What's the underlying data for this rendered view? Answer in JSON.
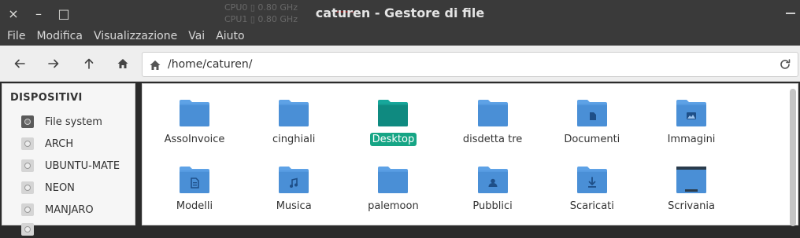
{
  "window": {
    "title": "caturen - Gestore di file",
    "controls": {
      "close": "×",
      "minimize": "–",
      "maximize": "□"
    },
    "overlay": {
      "rows": [
        "CPU0  ▯ 0.80 GHz",
        "CPU1  ▯ 0.80 GHz"
      ]
    }
  },
  "menubar": {
    "items": [
      "File",
      "Modifica",
      "Visualizzazione",
      "Vai",
      "Aiuto"
    ]
  },
  "toolbar": {
    "buttons": [
      "back-arrow-icon",
      "forward-arrow-icon",
      "up-arrow-icon",
      "home-icon"
    ],
    "location": "/home/caturen/"
  },
  "sidebar": {
    "header": "DISPOSITIVI",
    "devices": [
      "File system",
      "ARCH",
      "UBUNTU-MATE",
      "NEON",
      "MANJARO"
    ]
  },
  "files": [
    {
      "name": "AssoInvoice",
      "icon": "folder-icon"
    },
    {
      "name": "cinghiali",
      "icon": "folder-icon"
    },
    {
      "name": "Desktop",
      "icon": "folder-desktop-icon",
      "selected": true
    },
    {
      "name": "disdetta tre",
      "icon": "folder-icon"
    },
    {
      "name": "Documenti",
      "icon": "folder-documents-icon"
    },
    {
      "name": "Immagini",
      "icon": "folder-pictures-icon"
    },
    {
      "name": "Modelli",
      "icon": "folder-templates-icon"
    },
    {
      "name": "Musica",
      "icon": "folder-music-icon"
    },
    {
      "name": "palemoon",
      "icon": "folder-icon"
    },
    {
      "name": "Pubblici",
      "icon": "folder-public-icon"
    },
    {
      "name": "Scaricati",
      "icon": "folder-download-icon"
    },
    {
      "name": "Scrivania",
      "icon": "folder-desktop-dark-icon"
    }
  ],
  "colors": {
    "folder": "#4a8fd6",
    "folder_tab": "#5ea2e6",
    "desktop_folder": "#0f8a80",
    "selection": "#16a585"
  }
}
